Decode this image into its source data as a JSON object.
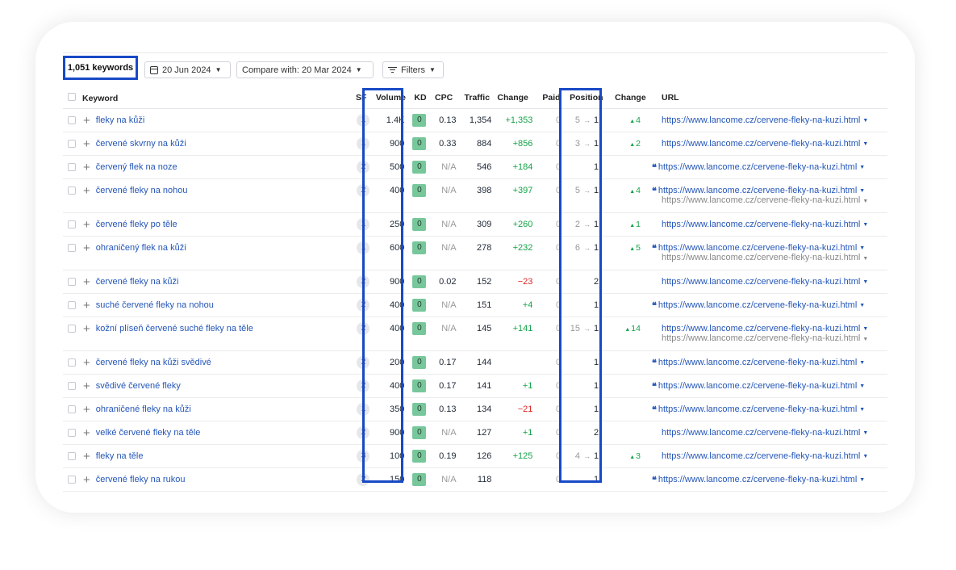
{
  "toolbar": {
    "keyword_count": "1,051 keywords",
    "date": "20 Jun 2024",
    "compare": "Compare with: 20 Mar 2024",
    "filters": "Filters"
  },
  "columns": {
    "keyword": "Keyword",
    "sf": "SF",
    "volume": "Volume",
    "kd": "KD",
    "cpc": "CPC",
    "traffic": "Traffic",
    "change": "Change",
    "paid": "Paid",
    "position": "Position",
    "pos_change": "Change",
    "url": "URL"
  },
  "rows": [
    {
      "keyword": "fleky na kůži",
      "sf": "1",
      "volume": "1.4K",
      "kd": "0",
      "cpc": "0.13",
      "traffic": "1,354",
      "change": "+1,353",
      "change_type": "pos",
      "paid": "0",
      "pos_from": "5",
      "position": "1",
      "pos_change": "4",
      "quote": false,
      "url": "https://www.lancome.cz/cervene-fleky-na-kuzi.html",
      "url2": ""
    },
    {
      "keyword": "červené skvrny na kůži",
      "sf": "1",
      "volume": "900",
      "kd": "0",
      "cpc": "0.33",
      "traffic": "884",
      "change": "+856",
      "change_type": "pos",
      "paid": "0",
      "pos_from": "3",
      "position": "1",
      "pos_change": "2",
      "quote": false,
      "url": "https://www.lancome.cz/cervene-fleky-na-kuzi.html",
      "url2": ""
    },
    {
      "keyword": "červený flek na noze",
      "sf": "2",
      "volume": "500",
      "kd": "0",
      "cpc": "N/A",
      "traffic": "546",
      "change": "+184",
      "change_type": "pos",
      "paid": "0",
      "pos_from": "",
      "position": "1",
      "pos_change": "",
      "quote": true,
      "url": "https://www.lancome.cz/cervene-fleky-na-kuzi.html",
      "url2": ""
    },
    {
      "keyword": "červené fleky na nohou",
      "sf": "2",
      "volume": "400",
      "kd": "0",
      "cpc": "N/A",
      "traffic": "398",
      "change": "+397",
      "change_type": "pos",
      "paid": "0",
      "pos_from": "5",
      "position": "1",
      "pos_change": "4",
      "quote": true,
      "url": "https://www.lancome.cz/cervene-fleky-na-kuzi.html",
      "url2": "https://www.lancome.cz/cervene-fleky-na-kuzi.html"
    },
    {
      "keyword": "červené fleky po těle",
      "sf": "1",
      "volume": "250",
      "kd": "0",
      "cpc": "N/A",
      "traffic": "309",
      "change": "+260",
      "change_type": "pos",
      "paid": "0",
      "pos_from": "2",
      "position": "1",
      "pos_change": "1",
      "quote": false,
      "url": "https://www.lancome.cz/cervene-fleky-na-kuzi.html",
      "url2": ""
    },
    {
      "keyword": "ohraničený flek na kůži",
      "sf": "1",
      "volume": "600",
      "kd": "0",
      "cpc": "N/A",
      "traffic": "278",
      "change": "+232",
      "change_type": "pos",
      "paid": "0",
      "pos_from": "6",
      "position": "1",
      "pos_change": "5",
      "quote": true,
      "url": "https://www.lancome.cz/cervene-fleky-na-kuzi.html",
      "url2": "https://www.lancome.cz/cervene-fleky-na-kuzi.html"
    },
    {
      "keyword": "červené fleky na kůži",
      "sf": "2",
      "volume": "900",
      "kd": "0",
      "cpc": "0.02",
      "traffic": "152",
      "change": "−23",
      "change_type": "neg",
      "paid": "0",
      "pos_from": "",
      "position": "2",
      "pos_change": "",
      "quote": false,
      "url": "https://www.lancome.cz/cervene-fleky-na-kuzi.html",
      "url2": ""
    },
    {
      "keyword": "suché červené fleky na nohou",
      "sf": "2",
      "volume": "400",
      "kd": "0",
      "cpc": "N/A",
      "traffic": "151",
      "change": "+4",
      "change_type": "pos",
      "paid": "0",
      "pos_from": "",
      "position": "1",
      "pos_change": "",
      "quote": true,
      "url": "https://www.lancome.cz/cervene-fleky-na-kuzi.html",
      "url2": ""
    },
    {
      "keyword": "kožní plíseň červené suché fleky na těle",
      "sf": "2",
      "volume": "400",
      "kd": "0",
      "cpc": "N/A",
      "traffic": "145",
      "change": "+141",
      "change_type": "pos",
      "paid": "0",
      "pos_from": "15",
      "position": "1",
      "pos_change": "14",
      "quote": false,
      "url": "https://www.lancome.cz/cervene-fleky-na-kuzi.html",
      "url2": "https://www.lancome.cz/cervene-fleky-na-kuzi.html"
    },
    {
      "keyword": "červené fleky na kůži svědivé",
      "sf": "2",
      "volume": "200",
      "kd": "0",
      "cpc": "0.17",
      "traffic": "144",
      "change": "",
      "change_type": "pos",
      "paid": "0",
      "pos_from": "",
      "position": "1",
      "pos_change": "",
      "quote": true,
      "url": "https://www.lancome.cz/cervene-fleky-na-kuzi.html",
      "url2": ""
    },
    {
      "keyword": "svědivé červené fleky",
      "sf": "2",
      "volume": "400",
      "kd": "0",
      "cpc": "0.17",
      "traffic": "141",
      "change": "+1",
      "change_type": "pos",
      "paid": "0",
      "pos_from": "",
      "position": "1",
      "pos_change": "",
      "quote": true,
      "url": "https://www.lancome.cz/cervene-fleky-na-kuzi.html",
      "url2": ""
    },
    {
      "keyword": "ohraničené fleky na kůži",
      "sf": "1",
      "volume": "350",
      "kd": "0",
      "cpc": "0.13",
      "traffic": "134",
      "change": "−21",
      "change_type": "neg",
      "paid": "0",
      "pos_from": "",
      "position": "1",
      "pos_change": "",
      "quote": true,
      "url": "https://www.lancome.cz/cervene-fleky-na-kuzi.html",
      "url2": ""
    },
    {
      "keyword": "velké červené fleky na těle",
      "sf": "2",
      "volume": "900",
      "kd": "0",
      "cpc": "N/A",
      "traffic": "127",
      "change": "+1",
      "change_type": "pos",
      "paid": "0",
      "pos_from": "",
      "position": "2",
      "pos_change": "",
      "quote": false,
      "url": "https://www.lancome.cz/cervene-fleky-na-kuzi.html",
      "url2": ""
    },
    {
      "keyword": "fleky na těle",
      "sf": "3",
      "volume": "100",
      "kd": "0",
      "cpc": "0.19",
      "traffic": "126",
      "change": "+125",
      "change_type": "pos",
      "paid": "0",
      "pos_from": "4",
      "position": "1",
      "pos_change": "3",
      "quote": false,
      "url": "https://www.lancome.cz/cervene-fleky-na-kuzi.html",
      "url2": ""
    },
    {
      "keyword": "červené fleky na rukou",
      "sf": "2",
      "volume": "150",
      "kd": "0",
      "cpc": "N/A",
      "traffic": "118",
      "change": "",
      "change_type": "pos",
      "paid": "0",
      "pos_from": "",
      "position": "1",
      "pos_change": "",
      "quote": true,
      "url": "https://www.lancome.cz/cervene-fleky-na-kuzi.html",
      "url2": ""
    }
  ]
}
